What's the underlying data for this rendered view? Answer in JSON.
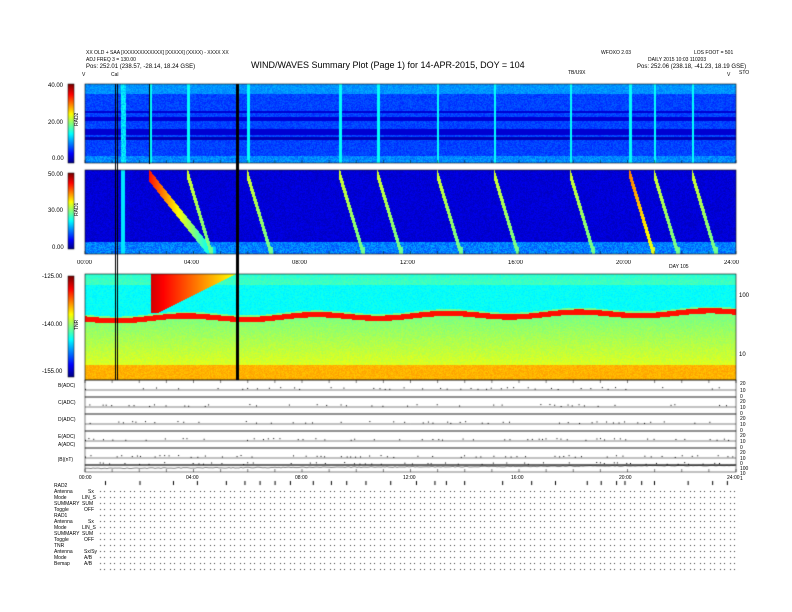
{
  "header": {
    "title": "WIND/WAVES Summary Plot (Page 1) for 14-APR-2015, DOY = 104",
    "left_line1": "XX OLD + SAA [XXXXXXXXXXXX] [XXXXX] (XXXX) - XXXX XX",
    "left_line2": "ADJ FREQ 3 = 130.00",
    "left_line3": "Pos:  252.01 (238.57, -28.14, 18.24 GSE)",
    "right_line1": "WFOXO 2.03",
    "right_line2": "DAILY 2015 10:03 110203",
    "right_line3": "Pos:  252.06 (238.18, -41.23, 18.19 GSE)",
    "right_corner": "LOS FOOT = 501",
    "cal_label": "Cal",
    "tb_label": "TB/U9X",
    "v_left": "V",
    "v_right": "V",
    "sto_label": "STO"
  },
  "colors": {
    "background": "#ffffff",
    "spectrum_low": "#0a1f9e",
    "spectrum_mid": "#35c8f0",
    "spectrum_high": "#d21a10",
    "trace": "#000000"
  },
  "chart_data": [
    {
      "type": "heatmap",
      "title": "RAD2",
      "ylabel": "RAD2",
      "yticks": [
        "40.00",
        "20.00",
        "0.00"
      ],
      "ylim": [
        0,
        40
      ],
      "note": "Dynamic spectrum, narrowband interference lines near 17–25 MHz"
    },
    {
      "type": "heatmap",
      "title": "RAD1",
      "ylabel": "RAD1",
      "yticks": [
        "50.00",
        "30.00",
        "0.00"
      ],
      "ylim": [
        0,
        50
      ],
      "xticks": [
        "00:00",
        "04:00",
        "08:00",
        "12:00",
        "16:00",
        "20:00",
        "24:00"
      ],
      "xlim": [
        0,
        24
      ],
      "bursts_hours": [
        2.4,
        3.8,
        6.0,
        9.4,
        10.8,
        13.0,
        15.1,
        17.9,
        20.1,
        21.0,
        22.4
      ],
      "tick_text_right": "DAY 105"
    },
    {
      "type": "heatmap",
      "title": "TNR",
      "ylabel": "TNR",
      "yticks": [
        "-125.00",
        "-140.00",
        "-155.00"
      ],
      "right_ticks": [
        "100",
        "10"
      ],
      "plasma_line_note": "red plasma line drifting from ~-133 to ~-131"
    },
    {
      "type": "line",
      "panels": [
        {
          "label": "B(ADC)",
          "right_ticks": [
            "20",
            "10",
            "0"
          ]
        },
        {
          "label": "C(ADC)",
          "right_ticks": [
            "20",
            "10",
            "0"
          ]
        },
        {
          "label": "D(ADC)",
          "right_ticks": [
            "20",
            "10",
            "0"
          ]
        },
        {
          "label": "E(ADC)",
          "right_ticks": [
            "20",
            "10",
            "0"
          ]
        },
        {
          "label": "A(ADC)",
          "right_ticks": [
            "20",
            "10",
            "0"
          ]
        },
        {
          "label": "|B|(nT)",
          "right_ticks": [
            "100",
            "10",
            "1"
          ]
        }
      ],
      "xticks": [
        "00:00",
        "04:00",
        "08:00",
        "12:00",
        "16:00",
        "20:00",
        "24:00"
      ]
    }
  ],
  "footer": {
    "rad2_title": "RAD2",
    "rad2_rows": [
      {
        "label": "Antenna",
        "value": "Sx"
      },
      {
        "label": "Mode",
        "value": "LIN_S"
      },
      {
        "label": "SUMMARY",
        "value": "SUM"
      },
      {
        "label": "Toggle",
        "value": "OFF"
      }
    ],
    "rad1_title": "RAD1",
    "rad1_rows": [
      {
        "label": "Antenna",
        "value": "Sx"
      },
      {
        "label": "Mode",
        "value": "LIN_S"
      },
      {
        "label": "SUMMARY",
        "value": "SUM"
      },
      {
        "label": "Toggle",
        "value": "OFF"
      }
    ],
    "tnr_title": "TNR",
    "tnr_rows": [
      {
        "label": "Antenna",
        "value": "Sx/Sy"
      },
      {
        "label": "Mode",
        "value": "A/B"
      },
      {
        "label": "Bemap",
        "value": "A/B"
      }
    ]
  }
}
